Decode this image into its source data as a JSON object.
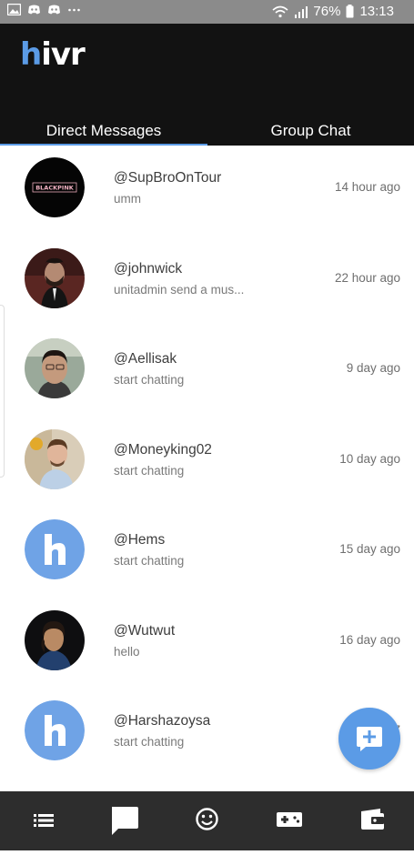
{
  "status_bar": {
    "battery": "76%",
    "time": "13:13"
  },
  "app": {
    "logo_h": "h",
    "logo_rest": "ivr"
  },
  "tabs": [
    {
      "label": "Direct Messages",
      "active": true
    },
    {
      "label": "Group Chat",
      "active": false
    }
  ],
  "conversations": [
    {
      "username": "@SupBroOnTour",
      "preview": "umm",
      "time": "14 hour ago",
      "avatar": "blackpink-logo",
      "avatar_text": "BLACKPINK"
    },
    {
      "username": "@johnwick",
      "preview": "unitadmin send a mus...",
      "time": "22 hour ago",
      "avatar": "photo"
    },
    {
      "username": "@Aellisak",
      "preview": "start chatting",
      "time": "9 day ago",
      "avatar": "photo"
    },
    {
      "username": "@Moneyking02",
      "preview": "start chatting",
      "time": "10 day ago",
      "avatar": "photo"
    },
    {
      "username": "@Hems",
      "preview": "start chatting",
      "time": "15 day ago",
      "avatar": "hivr-default"
    },
    {
      "username": "@Wutwut",
      "preview": "hello",
      "time": "16 day ago",
      "avatar": "photo"
    },
    {
      "username": "@Harshazoysa",
      "preview": "start chatting",
      "time": "17",
      "avatar": "hivr-default"
    }
  ],
  "bottom_nav": [
    {
      "icon": "list-icon",
      "active": false
    },
    {
      "icon": "chat-bubble-icon",
      "active": true
    },
    {
      "icon": "smiley-icon",
      "active": false
    },
    {
      "icon": "gamepad-icon",
      "active": false
    },
    {
      "icon": "wallet-icon",
      "active": false
    }
  ],
  "colors": {
    "accent": "#5b9be6",
    "header_bg": "#121212",
    "status_bg": "#8b8b8b",
    "nav_bg": "#2d2d2d"
  }
}
